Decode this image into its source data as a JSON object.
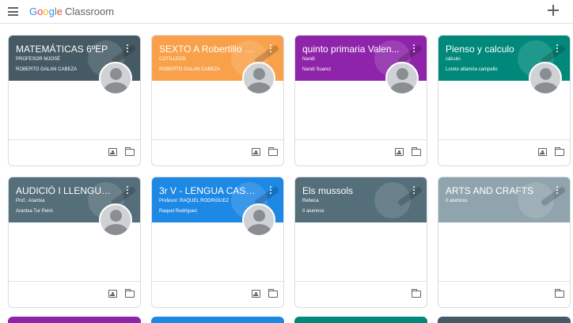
{
  "app": {
    "brand_google": "Google",
    "brand_product": "Classroom",
    "menu_icon": "hamburger-menu-icon",
    "add_icon": "plus-icon"
  },
  "colors": {
    "brand_letters": [
      "#4285f4",
      "#ea4335",
      "#fbbc05",
      "#4285f4",
      "#34a853",
      "#ea4335"
    ]
  },
  "classes": [
    {
      "title": "MATEMÁTICAS 6ºEP",
      "section": "PROFESOR MJOSÉ",
      "teacher": "ROBERTO GALAN CABEZA",
      "color": "#455a64",
      "has_assign": true
    },
    {
      "title": "SEXTO A Robertillo ar...",
      "section": "COTILLEOS",
      "teacher": "ROBERTO GALAN CABEZA",
      "color": "#f9a14a",
      "has_assign": true
    },
    {
      "title": "quinto primaria Valen...",
      "section": "Nandi",
      "teacher": "Nandi Suarez",
      "color": "#8e24aa",
      "has_assign": true
    },
    {
      "title": "Pienso y calculo",
      "section": "cálculo",
      "teacher": "Loreto altamira campello",
      "color": "#00897b",
      "has_assign": true
    },
    {
      "title": "AUDICIÓ I LLENGUAT...",
      "section": "Prof.: Arantxa",
      "teacher": "Arantxa Tur Peiró",
      "color": "#546e7a",
      "has_assign": true
    },
    {
      "title": "3r V - LENGUA CASTE...",
      "section": "Profesor: RAQUEL RODRIGUEZ",
      "teacher": "Raquel Rodríguez",
      "color": "#1e88e5",
      "has_assign": true
    },
    {
      "title": "Els mussols",
      "section": "Rebeca",
      "teacher": "0 alumnos",
      "color": "#546e7a",
      "has_assign": false
    },
    {
      "title": "ARTS AND CRAFTS",
      "section": "0 alumnos",
      "teacher": "",
      "color": "#90a4ae",
      "has_assign": false
    }
  ],
  "next_row_colors": [
    "#8e24aa",
    "#1e88e5",
    "#00897b",
    "#455a64"
  ]
}
